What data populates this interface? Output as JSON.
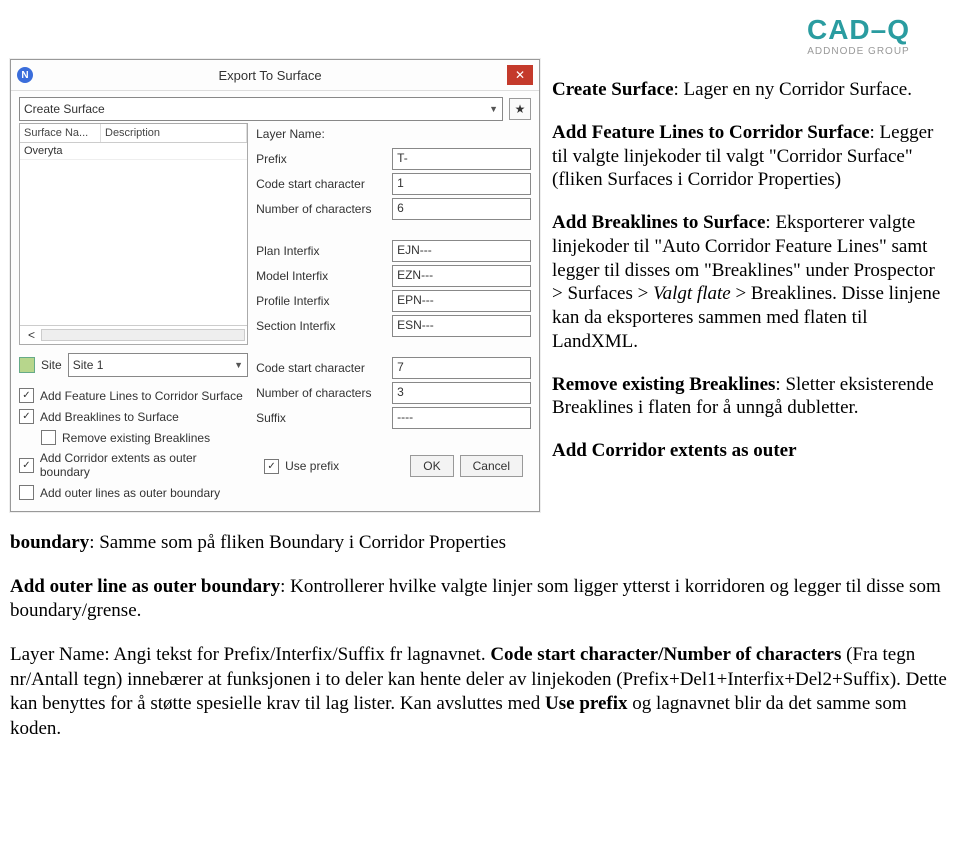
{
  "logo": {
    "main": "CAD–Q",
    "sub": "ADDNODE GROUP"
  },
  "dialog": {
    "title": "Export To Surface",
    "combo_top": "Create Surface",
    "new_icon": "★",
    "list": {
      "col1": "Surface Na...",
      "col2": "Description",
      "row1": "Overyta",
      "foot_chevron": "<"
    },
    "site_label": "Site",
    "site_value": "Site 1",
    "checks": {
      "c1": "Add Feature Lines to Corridor Surface",
      "c2": "Add Breaklines to Surface",
      "c3": "Remove existing Breaklines",
      "c4": "Add Corridor extents as outer boundary",
      "c5": "Add outer lines as outer boundary"
    },
    "form": {
      "layer_label": "Layer Name:",
      "prefix_label": "Prefix",
      "prefix_val": "T-",
      "csc1_label": "Code start character",
      "csc1_val": "1",
      "noc1_label": "Number of characters",
      "noc1_val": "6",
      "plan_label": "Plan Interfix",
      "plan_val": "EJN---",
      "model_label": "Model Interfix",
      "model_val": "EZN---",
      "profile_label": "Profile Interfix",
      "profile_val": "EPN---",
      "section_label": "Section Interfix",
      "section_val": "ESN---",
      "csc2_label": "Code start character",
      "csc2_val": "7",
      "noc2_label": "Number of characters",
      "noc2_val": "3",
      "suffix_label": "Suffix",
      "suffix_val": "----",
      "useprefix_label": "Use prefix"
    },
    "ok": "OK",
    "cancel": "Cancel"
  },
  "right": {
    "p1b": "Create Surface",
    "p1": ": Lager en ny Corridor Surface.",
    "p2b": "Add Feature Lines to Corridor Surface",
    "p2": ": Legger til valgte linjekoder til valgt \"Corridor Surface\" (fliken Surfaces i Corridor Properties)",
    "p3b": "Add Breaklines to Surface",
    "p3": ": Eksporterer valgte linjekoder til \"Auto Corridor Feature Lines\" samt legger til disses om \"Breaklines\" under Prospector > Surfaces > ",
    "p3i": "Valgt flate",
    "p3c": " > Breaklines. Disse linjene kan da eksporteres sammen med flaten til LandXML.",
    "p4b": "Remove existing Breaklines",
    "p4": ": Sletter eksisterende Breaklines i flaten for å unngå dubletter.",
    "p5b": "Add Corridor extents as outer"
  },
  "below": {
    "l1b": "boundary",
    "l1": ": Samme som på fliken Boundary i Corridor Properties",
    "l2b": "Add outer line as outer boundary",
    "l2": ": Kontrollerer hvilke valgte linjer som ligger ytterst i korridoren og legger til disse som boundary/grense.",
    "l3a": "Layer Name: Angi tekst for Prefix/Interfix/Suffix fr lagnavnet. ",
    "l3b": "Code start character/Number of characters",
    "l3c": " (Fra tegn nr/Antall tegn) innebærer at funksjonen i to deler kan hente deler av linjekoden (Prefix+Del1+Interfix+Del2+Suffix). Dette kan benyttes for å støtte spesielle krav til lag lister. Kan avsluttes med ",
    "l3d": "Use prefix",
    "l3e": " og lagnavnet blir da det samme som koden."
  }
}
